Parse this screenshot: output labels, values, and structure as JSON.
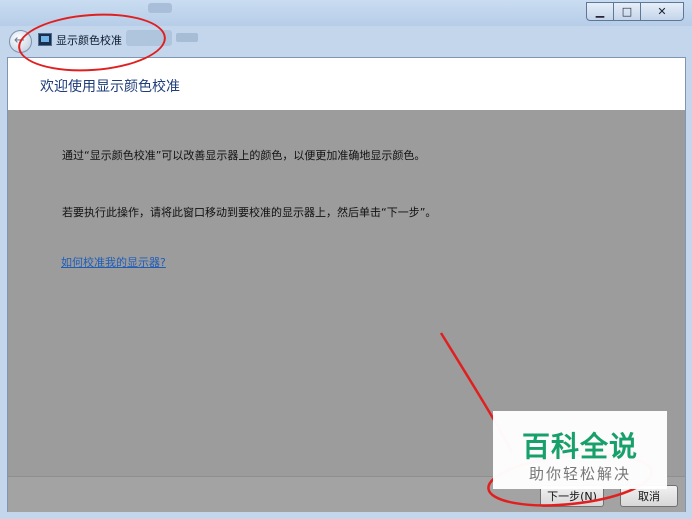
{
  "window": {
    "app_title": "显示颜色校准",
    "minimize_glyph": "▁",
    "maximize_glyph": "□",
    "close_glyph": "✕"
  },
  "page": {
    "heading": "欢迎使用显示颜色校准",
    "para1": "通过“显示颜色校准”可以改善显示器上的颜色，以便更加准确地显示颜色。",
    "para2": "若要执行此操作，请将此窗口移动到要校准的显示器上，然后单击“下一步”。",
    "help_link": "如何校准我的显示器?"
  },
  "footer": {
    "next_label": "下一步(N)",
    "cancel_label": "取消"
  },
  "watermark": {
    "main": "百科全说",
    "sub": "助你轻松解决"
  },
  "colors": {
    "annotation": "#e02020",
    "heading": "#1f3d7a",
    "link": "#1f5db8",
    "watermark": "#18a06b"
  },
  "icons": [
    "back-arrow-icon",
    "display-calibration-icon"
  ]
}
